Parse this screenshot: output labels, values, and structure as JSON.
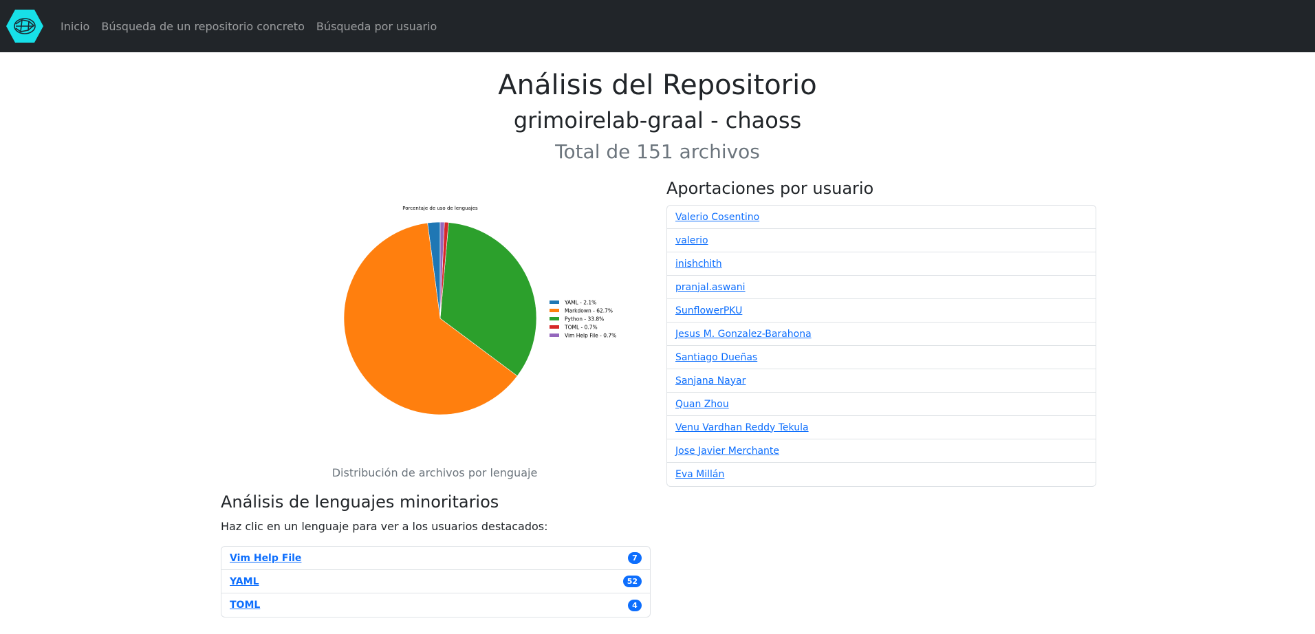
{
  "nav": {
    "links": [
      "Inicio",
      "Búsqueda de un repositorio concreto",
      "Búsqueda por usuario"
    ]
  },
  "header": {
    "title": "Análisis del Repositorio",
    "repo": "grimoirelab-graal - chaoss",
    "total": "Total de 151 archivos"
  },
  "chart_data": {
    "type": "pie",
    "title": "Porcentaje de uso de lenguajes",
    "categories": [
      "YAML",
      "Markdown",
      "Python",
      "TOML",
      "Vim Help File"
    ],
    "values": [
      2.1,
      62.7,
      33.8,
      0.7,
      0.7
    ],
    "legend_labels": [
      "YAML - 2.1%",
      "Markdown - 62.7%",
      "Python - 33.8%",
      "TOML - 0.7%",
      "Vim Help File - 0.7%"
    ],
    "colors": [
      "#1f77b4",
      "#ff7f0e",
      "#2ca02c",
      "#d62728",
      "#9467bd"
    ],
    "legend_position": "right"
  },
  "chart_caption": "Distribución de archivos por lenguaje",
  "minority": {
    "title": "Análisis de lenguajes minoritarios",
    "hint": "Haz clic en un lenguaje para ver a los usuarios destacados:",
    "items": [
      {
        "label": "Vim Help File",
        "count": "7"
      },
      {
        "label": "YAML",
        "count": "52"
      },
      {
        "label": "TOML",
        "count": "4"
      }
    ]
  },
  "contributors": {
    "title": "Aportaciones por usuario",
    "users": [
      "Valerio Cosentino",
      "valerio",
      "inishchith",
      "pranjal.aswani",
      "SunflowerPKU",
      "Jesus M. Gonzalez-Barahona",
      "Santiago Dueñas",
      "Sanjana Nayar",
      "Quan Zhou",
      "Venu Vardhan Reddy Tekula",
      "Jose Javier Merchante",
      "Eva Millán"
    ]
  }
}
